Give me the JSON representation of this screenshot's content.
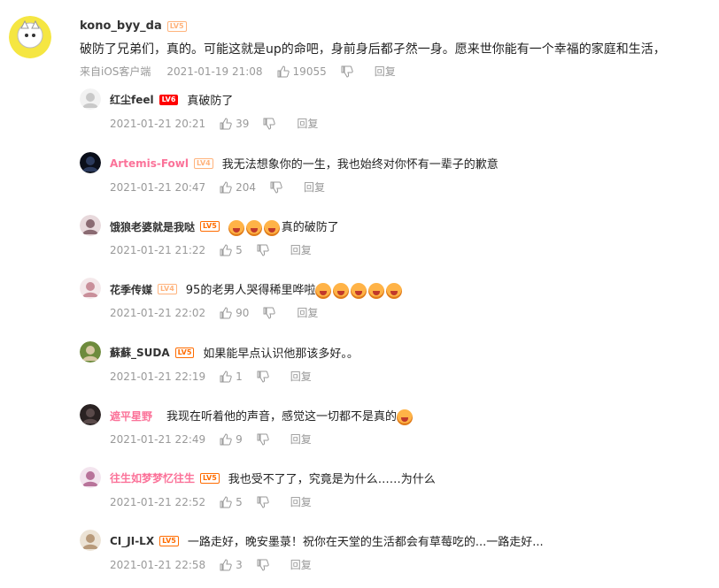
{
  "main_comment": {
    "username": "kono_byy_da",
    "level": "LV5",
    "text": "破防了兄弟们，真的。可能这就是up的命吧，身前身后都孑然一身。愿来世你能有一个幸福的家庭和生活，",
    "source": "来自iOS客户端",
    "time": "2021-01-19 21:08",
    "likes": "19055",
    "reply_label": "回复"
  },
  "replies": [
    {
      "username": "红尘feel",
      "level": "LV6",
      "text": "真破防了",
      "time": "2021-01-21 20:21",
      "likes": "39",
      "reply_label": "回复",
      "name_color": "normal",
      "emoji_count": 0
    },
    {
      "username": "Artemis-Fowl",
      "level": "LV4",
      "text": "我无法想象你的一生，我也始终对你怀有一辈子的歉意",
      "time": "2021-01-21 20:47",
      "likes": "204",
      "reply_label": "回复",
      "name_color": "pink",
      "emoji_count": 0
    },
    {
      "username": "饿狼老婆就是我哒",
      "level": "LV5",
      "text": "真的破防了",
      "time": "2021-01-21 21:22",
      "likes": "5",
      "reply_label": "回复",
      "name_color": "normal",
      "emoji_count": 3,
      "emoji_position": "before"
    },
    {
      "username": "花季传媒",
      "level": "LV4",
      "text": "95的老男人哭得稀里哗啦",
      "time": "2021-01-21 22:02",
      "likes": "90",
      "reply_label": "回复",
      "name_color": "normal",
      "emoji_count": 5,
      "emoji_position": "after"
    },
    {
      "username": "蘇蘇_SUDA",
      "level": "LV5",
      "text": "如果能早点认识他那该多好。。",
      "time": "2021-01-21 22:19",
      "likes": "1",
      "reply_label": "回复",
      "name_color": "normal",
      "emoji_count": 0
    },
    {
      "username": "遮平星野",
      "level": "",
      "text": "我现在听着他的声音，感觉这一切都不是真的",
      "time": "2021-01-21 22:49",
      "likes": "9",
      "reply_label": "回复",
      "name_color": "pink",
      "emoji_count": 1,
      "emoji_position": "after"
    },
    {
      "username": "往生如梦梦忆往生",
      "level": "LV5",
      "text": "我也受不了了，究竟是为什么……为什么",
      "time": "2021-01-21 22:52",
      "likes": "5",
      "reply_label": "回复",
      "name_color": "pink",
      "emoji_count": 0
    },
    {
      "username": "CI_JI-LX",
      "level": "LV5",
      "text": "一路走好，晚安墨菉！祝你在天堂的生活都会有草莓吃的...一路走好...",
      "time": "2021-01-21 22:58",
      "likes": "3",
      "reply_label": "回复",
      "name_color": "normal",
      "emoji_count": 0
    }
  ],
  "icons": {
    "like": "thumb-up-icon",
    "dislike": "thumb-down-icon"
  },
  "colors": {
    "username_pink": "#fb7299",
    "meta_gray": "#999999",
    "level_orange": "#ff6c00"
  }
}
